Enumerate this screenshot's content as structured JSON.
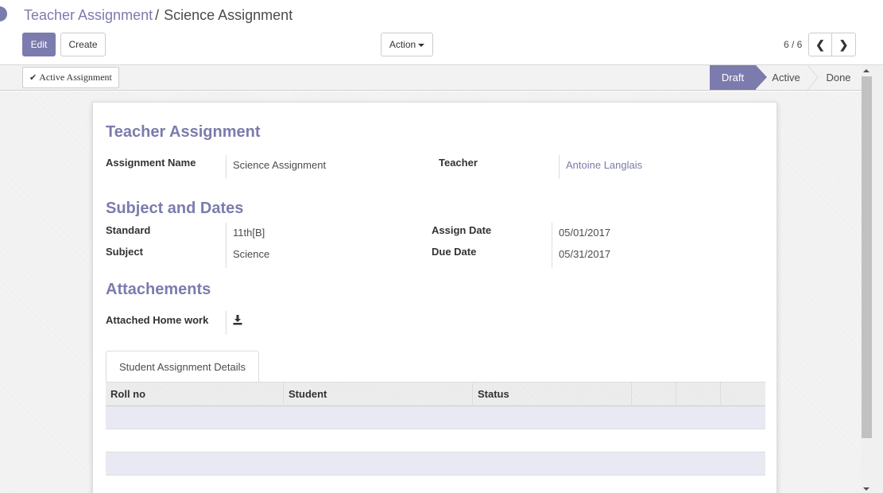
{
  "breadcrumb": {
    "parent": "Teacher Assignment",
    "separator": "/",
    "current": "Science Assignment"
  },
  "toolbar": {
    "edit_label": "Edit",
    "create_label": "Create",
    "action_label": "Action"
  },
  "pager": {
    "value": "6 / 6",
    "prev": "❮",
    "next": "❯"
  },
  "statusbar": {
    "active_button_label": "Active Assignment",
    "stages": [
      {
        "label": "Draft",
        "current": true
      },
      {
        "label": "Active",
        "current": false
      },
      {
        "label": "Done",
        "current": false
      }
    ]
  },
  "form": {
    "teacher_assignment": {
      "title": "Teacher Assignment",
      "assignment_name_label": "Assignment Name",
      "assignment_name_value": "Science Assignment",
      "teacher_label": "Teacher",
      "teacher_value": "Antoine Langlais"
    },
    "subject_dates": {
      "title": "Subject and Dates",
      "standard_label": "Standard",
      "standard_value": "11th[B]",
      "subject_label": "Subject",
      "subject_value": "Science",
      "assign_date_label": "Assign Date",
      "assign_date_value": "05/01/2017",
      "due_date_label": "Due Date",
      "due_date_value": "05/31/2017"
    },
    "attachments": {
      "title": "Attachements",
      "home_work_label": "Attached Home work",
      "home_work_icon": "download-icon"
    },
    "notebook": {
      "tab_label": "Student Assignment Details",
      "columns": [
        "Roll no",
        "Student",
        "Status"
      ]
    }
  },
  "colors": {
    "brand": "#7c7bad",
    "row_stripe": "#e9e9f3"
  }
}
